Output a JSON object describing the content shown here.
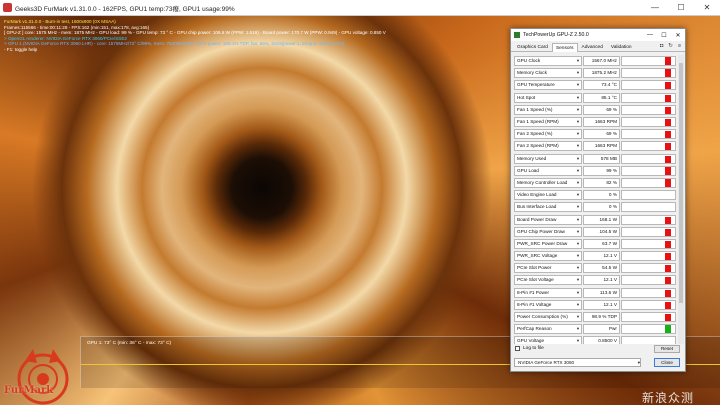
{
  "furmark": {
    "title": "Geeks3D FurMark v1.31.0.0 - 162FPS, GPU1 temp:73癈, GPU1 usage:99%",
    "hud": [
      {
        "text": "FurMark v1.31.0.0 - Burn-in test, 1600x900 (0X MSAA)",
        "color": "yellow"
      },
      {
        "text": "Frames:115566 - time:00:11:28 - FPS:162 (min:151, max:178, avg:165)",
        "color": "white"
      },
      {
        "text": "[ GPU-Z ] core: 1575 MHz - mem: 1875 MHz - GPU load: 99 % - GPU temp: 73 ° C - GPU chip power: 106.6 W (PPW: 1.519) - Board power: 170.7 W (PPW: 0.949) - GPU voltage: 0.850 V",
        "color": "white"
      },
      {
        "text": "> OpenGL renderer: NVIDIA GeForce RTX 3060/PCIe/SSE2",
        "color": "cyan"
      },
      {
        "text": "> GPU 1 (NVIDIA GeForce RTX 3060 LHR) - core: 1575MHz/72° C/99%, mem: 7500MHz/8%, GPU power: 100.1% TDP, fan: 69%, limits[power:1, temp:0, volt:0, OV:0]",
        "color": "blue"
      },
      {
        "text": "- F1: toggle help",
        "color": "white"
      }
    ],
    "graph_label": "GPU 1: 73° C (min: 36° C - max: 73° C)",
    "logo_text": "FurMark",
    "watermark": "新浪众测",
    "window_controls": [
      "—",
      "☐",
      "✕"
    ]
  },
  "gpuz": {
    "title": "TechPowerUp GPU-Z 2.50.0",
    "window_controls": [
      "—",
      "☐",
      "✕"
    ],
    "tabs": [
      "Graphics Card",
      "Sensors",
      "Advanced",
      "Validation"
    ],
    "active_tab": "Sensors",
    "tool_icons": [
      "camera-icon",
      "refresh-icon",
      "menu-icon"
    ],
    "tool_glyphs": [
      "◘",
      "↻",
      "≡"
    ],
    "sensors": [
      {
        "name": "GPU Clock",
        "value": "1567.0 MHz",
        "bar": "full"
      },
      {
        "name": "Memory Clock",
        "value": "1875.2 MHz",
        "bar": "full"
      },
      {
        "name": "GPU Temperature",
        "value": "73.4 °C",
        "bar": "red"
      },
      {
        "name": "Hot Spot",
        "value": "85.1 °C",
        "bar": "red"
      },
      {
        "name": "Fan 1 Speed (%)",
        "value": "69 %",
        "bar": "red"
      },
      {
        "name": "Fan 1 Speed (RPM)",
        "value": "1663 RPM",
        "bar": "red"
      },
      {
        "name": "Fan 2 Speed (%)",
        "value": "69 %",
        "bar": "red"
      },
      {
        "name": "Fan 2 Speed (RPM)",
        "value": "1663 RPM",
        "bar": "red"
      },
      {
        "name": "Memory Used",
        "value": "578 MB",
        "bar": "red"
      },
      {
        "name": "GPU Load",
        "value": "99 %",
        "bar": "full"
      },
      {
        "name": "Memory Controller Load",
        "value": "82 %",
        "bar": "full"
      },
      {
        "name": "Video Engine Load",
        "value": "0 %",
        "bar": "none"
      },
      {
        "name": "Bus Interface Load",
        "value": "0 %",
        "bar": "none"
      },
      {
        "name": "Board Power Draw",
        "value": "168.1 W",
        "bar": "red"
      },
      {
        "name": "GPU Chip Power Draw",
        "value": "104.5 W",
        "bar": "red"
      },
      {
        "name": "PWR_SRC Power Draw",
        "value": "63.7 W",
        "bar": "red"
      },
      {
        "name": "PWR_SRC Voltage",
        "value": "12.1 V",
        "bar": "red"
      },
      {
        "name": "PCIe Slot Power",
        "value": "54.5 W",
        "bar": "red"
      },
      {
        "name": "PCIe Slot Voltage",
        "value": "12.1 V",
        "bar": "red"
      },
      {
        "name": "8-Pin #1 Power",
        "value": "113.6 W",
        "bar": "red"
      },
      {
        "name": "8-Pin #1 Voltage",
        "value": "12.1 V",
        "bar": "red"
      },
      {
        "name": "Power Consumption (%)",
        "value": "98.9 % TDP",
        "bar": "red"
      },
      {
        "name": "PerfCap Reason",
        "value": "Pwr",
        "bar": "green"
      },
      {
        "name": "GPU Voltage",
        "value": "0.8500 V",
        "bar": "none"
      }
    ],
    "log_label": "Log to file",
    "reset_label": "Reset",
    "gpu_select": "NVIDIA GeForce RTX 3060",
    "close_label": "Close"
  }
}
